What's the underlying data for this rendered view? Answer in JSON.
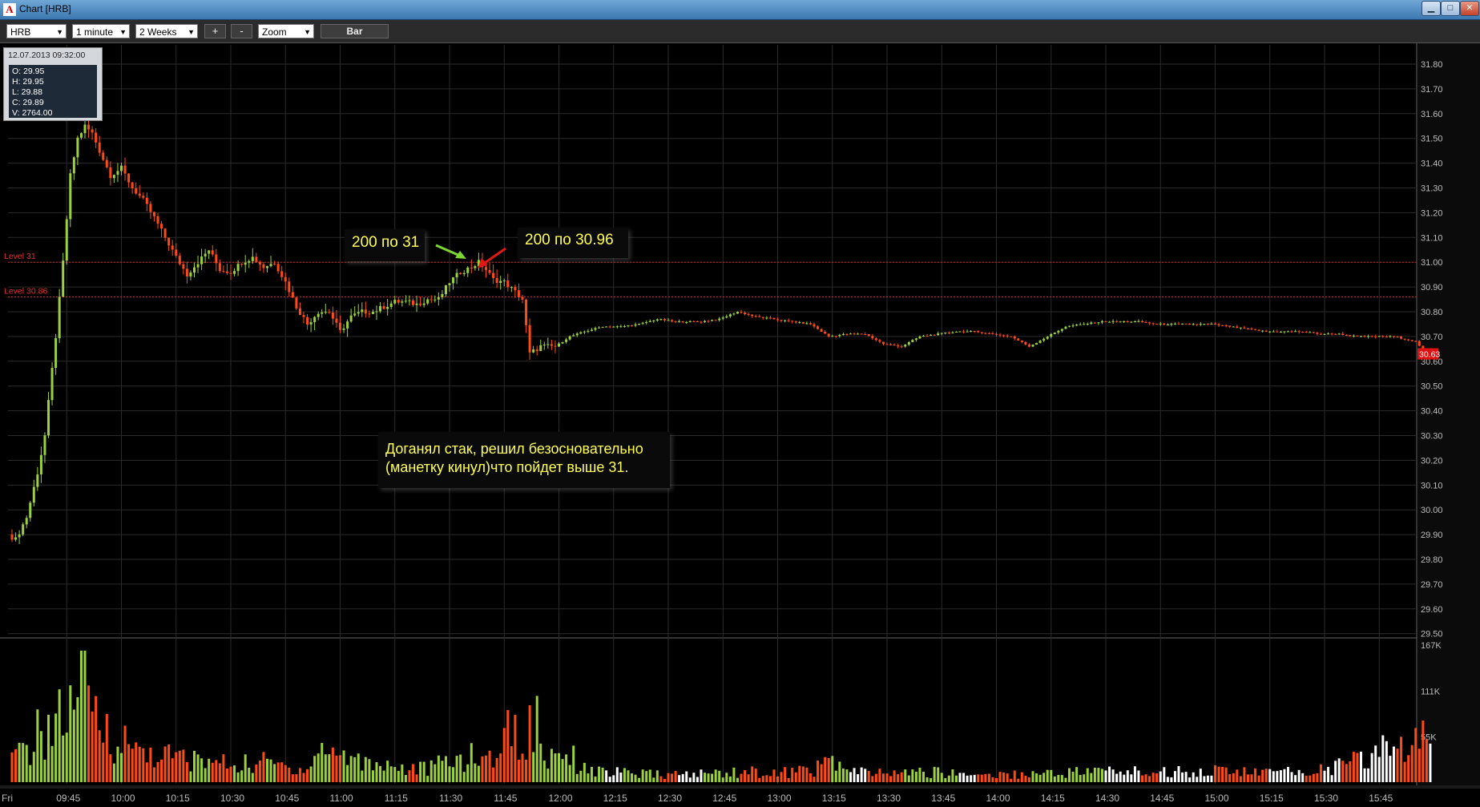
{
  "window": {
    "title": "Chart [HRB]",
    "icon": "A"
  },
  "toolbar": {
    "symbol": "HRB",
    "interval": "1 minute",
    "range": "2 Weeks",
    "plus_label": "+",
    "minus_label": "-",
    "zoom": "Zoom",
    "bar_label": "Bar"
  },
  "tooltip": {
    "datetime": "12.07.2013 09:32:00",
    "open": "O: 29.95",
    "high": "H: 29.95",
    "low": "L: 29.88",
    "close": "C: 29.89",
    "volume": "V: 2764.00"
  },
  "annotations": {
    "buy_note": "200 по 31",
    "sell_note": "200 по 30.96",
    "comment_line1": "Доганял стак, решил безосновательно",
    "comment_line2": "(манетку кинул)что пойдет выше 31."
  },
  "colors": {
    "up": "#9cd13c",
    "down": "#ff4a14",
    "level": "#c8242a",
    "grid": "#2b2b2b",
    "last_price_bg": "#e01010"
  },
  "chart_data": {
    "type": "candlestick",
    "symbol": "HRB",
    "price_ticks": [
      31.8,
      31.7,
      31.6,
      31.5,
      31.4,
      31.3,
      31.2,
      31.1,
      31.0,
      30.9,
      30.8,
      30.7,
      30.6,
      30.5,
      30.4,
      30.3,
      30.2,
      30.1,
      30.0,
      29.9,
      29.8,
      29.7,
      29.6,
      29.5
    ],
    "price_tick_labels": [
      "31.80",
      "31.70",
      "31.60",
      "31.50",
      "31.40",
      "31.30",
      "31.20",
      "31.10",
      "31.00",
      "30.90",
      "30.80",
      "30.70",
      "30.60",
      "30.50",
      "30.40",
      "30.30",
      "30.20",
      "30.10",
      "30.00",
      "29.90",
      "29.80",
      "29.70",
      "29.60",
      "29.50"
    ],
    "ylim": [
      29.46,
      31.88
    ],
    "volume_ticks": [
      "167K",
      "111K",
      "55K"
    ],
    "volume_tick_values": [
      167,
      111,
      55
    ],
    "volume_max": 167,
    "time_labels": [
      "Fri",
      "09:45",
      "10:00",
      "10:15",
      "10:30",
      "10:45",
      "11:00",
      "11:15",
      "11:30",
      "11:45",
      "12:00",
      "12:15",
      "12:30",
      "12:45",
      "13:00",
      "13:15",
      "13:30",
      "13:45",
      "14:00",
      "14:15",
      "14:30",
      "14:45",
      "15:00",
      "15:15",
      "15:30",
      "15:45"
    ],
    "time_label_minutes": [
      0,
      15,
      30,
      45,
      60,
      75,
      90,
      105,
      120,
      135,
      150,
      165,
      180,
      195,
      210,
      225,
      240,
      255,
      270,
      285,
      300,
      315,
      330,
      345,
      360,
      375
    ],
    "session_minutes": 390,
    "levels": [
      {
        "label": "Level 31",
        "value": 31.0
      },
      {
        "label": "Level 30.86",
        "value": 30.86
      }
    ],
    "last_price_label": "30.63",
    "last_price": 30.63,
    "price_path": [
      [
        0,
        29.9
      ],
      [
        2,
        29.88
      ],
      [
        5,
        29.97
      ],
      [
        8,
        30.15
      ],
      [
        10,
        30.3
      ],
      [
        13,
        30.7
      ],
      [
        15,
        31.0
      ],
      [
        17,
        31.35
      ],
      [
        19,
        31.5
      ],
      [
        21,
        31.55
      ],
      [
        23,
        31.52
      ],
      [
        25,
        31.45
      ],
      [
        28,
        31.35
      ],
      [
        31,
        31.38
      ],
      [
        34,
        31.3
      ],
      [
        37,
        31.25
      ],
      [
        40,
        31.18
      ],
      [
        43,
        31.1
      ],
      [
        46,
        31.02
      ],
      [
        49,
        30.95
      ],
      [
        52,
        31.0
      ],
      [
        55,
        31.05
      ],
      [
        58,
        30.97
      ],
      [
        61,
        30.96
      ],
      [
        64,
        31.0
      ],
      [
        67,
        31.02
      ],
      [
        70,
        30.98
      ],
      [
        73,
        31.0
      ],
      [
        76,
        30.92
      ],
      [
        79,
        30.82
      ],
      [
        82,
        30.75
      ],
      [
        85,
        30.8
      ],
      [
        88,
        30.8
      ],
      [
        91,
        30.72
      ],
      [
        94,
        30.78
      ],
      [
        97,
        30.8
      ],
      [
        100,
        30.8
      ],
      [
        103,
        30.82
      ],
      [
        106,
        30.84
      ],
      [
        109,
        30.84
      ],
      [
        112,
        30.83
      ],
      [
        115,
        30.85
      ],
      [
        118,
        30.85
      ],
      [
        121,
        30.92
      ],
      [
        124,
        30.96
      ],
      [
        127,
        30.98
      ],
      [
        129,
        31.0
      ],
      [
        131,
        30.97
      ],
      [
        133,
        30.93
      ],
      [
        136,
        30.92
      ],
      [
        139,
        30.88
      ],
      [
        141,
        30.85
      ],
      [
        143,
        30.63
      ],
      [
        146,
        30.66
      ],
      [
        150,
        30.66
      ],
      [
        154,
        30.7
      ],
      [
        158,
        30.72
      ],
      [
        163,
        30.74
      ],
      [
        168,
        30.74
      ],
      [
        173,
        30.75
      ],
      [
        178,
        30.77
      ],
      [
        183,
        30.76
      ],
      [
        190,
        30.76
      ],
      [
        195,
        30.77
      ],
      [
        200,
        30.8
      ],
      [
        205,
        30.78
      ],
      [
        210,
        30.77
      ],
      [
        215,
        30.76
      ],
      [
        220,
        30.75
      ],
      [
        225,
        30.7
      ],
      [
        230,
        30.71
      ],
      [
        235,
        30.71
      ],
      [
        240,
        30.67
      ],
      [
        245,
        30.66
      ],
      [
        250,
        30.7
      ],
      [
        255,
        30.71
      ],
      [
        260,
        30.72
      ],
      [
        265,
        30.72
      ],
      [
        270,
        30.71
      ],
      [
        275,
        30.7
      ],
      [
        280,
        30.66
      ],
      [
        285,
        30.7
      ],
      [
        290,
        30.74
      ],
      [
        295,
        30.75
      ],
      [
        300,
        30.76
      ],
      [
        305,
        30.76
      ],
      [
        310,
        30.76
      ],
      [
        315,
        30.75
      ],
      [
        320,
        30.75
      ],
      [
        325,
        30.75
      ],
      [
        330,
        30.75
      ],
      [
        335,
        30.74
      ],
      [
        340,
        30.73
      ],
      [
        345,
        30.72
      ],
      [
        350,
        30.72
      ],
      [
        355,
        30.72
      ],
      [
        360,
        30.71
      ],
      [
        365,
        30.71
      ],
      [
        370,
        30.7
      ],
      [
        375,
        30.7
      ],
      [
        380,
        30.7
      ],
      [
        383,
        30.69
      ],
      [
        386,
        30.68
      ],
      [
        389,
        30.63
      ]
    ],
    "volume_profile": [
      [
        0,
        30
      ],
      [
        4,
        45
      ],
      [
        8,
        70
      ],
      [
        12,
        85
      ],
      [
        16,
        95
      ],
      [
        18,
        160
      ],
      [
        22,
        90
      ],
      [
        26,
        75
      ],
      [
        30,
        55
      ],
      [
        35,
        45
      ],
      [
        40,
        38
      ],
      [
        45,
        35
      ],
      [
        50,
        30
      ],
      [
        55,
        28
      ],
      [
        60,
        25
      ],
      [
        65,
        25
      ],
      [
        70,
        28
      ],
      [
        75,
        22
      ],
      [
        80,
        18
      ],
      [
        85,
        45
      ],
      [
        90,
        40
      ],
      [
        95,
        30
      ],
      [
        100,
        28
      ],
      [
        105,
        22
      ],
      [
        110,
        18
      ],
      [
        115,
        20
      ],
      [
        120,
        30
      ],
      [
        125,
        35
      ],
      [
        130,
        30
      ],
      [
        135,
        55
      ],
      [
        138,
        100
      ],
      [
        140,
        30
      ],
      [
        144,
        110
      ],
      [
        146,
        25
      ],
      [
        150,
        55
      ],
      [
        155,
        28
      ],
      [
        160,
        15
      ],
      [
        170,
        12
      ],
      [
        180,
        10
      ],
      [
        190,
        12
      ],
      [
        200,
        15
      ],
      [
        210,
        12
      ],
      [
        220,
        18
      ],
      [
        225,
        30
      ],
      [
        230,
        14
      ],
      [
        240,
        12
      ],
      [
        250,
        14
      ],
      [
        260,
        12
      ],
      [
        270,
        10
      ],
      [
        280,
        12
      ],
      [
        290,
        14
      ],
      [
        300,
        16
      ],
      [
        310,
        14
      ],
      [
        320,
        15
      ],
      [
        330,
        16
      ],
      [
        340,
        14
      ],
      [
        350,
        14
      ],
      [
        360,
        18
      ],
      [
        370,
        30
      ],
      [
        375,
        45
      ],
      [
        380,
        50
      ],
      [
        385,
        55
      ],
      [
        389,
        55
      ]
    ]
  }
}
